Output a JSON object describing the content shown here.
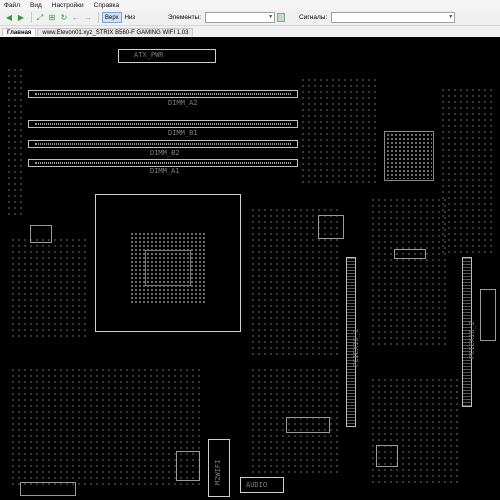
{
  "menu": [
    "Файл",
    "Вид",
    "Настройки",
    "Справка"
  ],
  "toolbar": {
    "icons": [
      "back-arrow-icon",
      "forward-arrow-icon",
      "zoom-fit-icon",
      "zoom-area-icon",
      "rotate-icon",
      "prev-icon",
      "next-icon"
    ],
    "view_top": "Верх",
    "view_bottom": "Низ",
    "elements_label": "Элементы:",
    "elements_value": "",
    "signals_label": "Сигналы:",
    "signals_value": ""
  },
  "tabs": {
    "main": "Главная",
    "file": "www.Elevon01.xyz_STRIX B560-F GAMING WIFI 1.03"
  },
  "board": {
    "labels": {
      "atx_pwr": "ATX_PWR",
      "dimm_b1": "DIMM_B1",
      "dimm_b2": "DIMM_B2",
      "dimm_a1": "DIMM_A1",
      "dimm_a2": "DIMM_A2",
      "pciex16_1": "PCIEX16_1",
      "pciex16_2": "PCIEX16_2",
      "m2wifi": "M2WIFI",
      "audio": "AUDIO"
    }
  }
}
